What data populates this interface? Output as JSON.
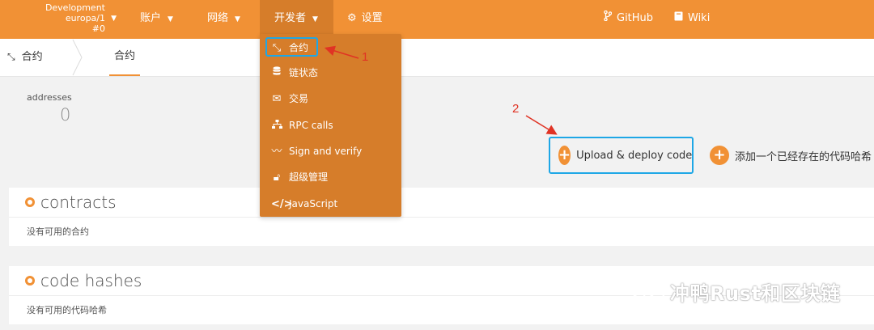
{
  "header": {
    "chain": {
      "line1": "Development",
      "line2": "europa/1",
      "line3": "#0"
    },
    "nav": [
      {
        "label": "账户"
      },
      {
        "label": "网络"
      },
      {
        "label": "开发者"
      },
      {
        "label": "设置",
        "icon": "gears-icon"
      }
    ],
    "links": [
      {
        "label": "GitHub",
        "icon": "branch-icon"
      },
      {
        "label": "Wiki",
        "icon": "book-icon"
      }
    ]
  },
  "subnav": {
    "crumb": "合约",
    "tab": "合约"
  },
  "summary": {
    "label": "addresses",
    "value": "0"
  },
  "actions": {
    "upload": "Upload & deploy code",
    "add_existing": "添加一个已经存在的代码哈希"
  },
  "sections": [
    {
      "title": "contracts",
      "empty": "没有可用的合约"
    },
    {
      "title": "code hashes",
      "empty": "没有可用的代码哈希"
    }
  ],
  "dropdown": [
    {
      "label": "合约",
      "icon": "compress-icon"
    },
    {
      "label": "链状态",
      "icon": "database-icon"
    },
    {
      "label": "交易",
      "icon": "envelope-icon"
    },
    {
      "label": "RPC calls",
      "icon": "sitemap-icon"
    },
    {
      "label": "Sign and verify",
      "icon": "signature-icon"
    },
    {
      "label": "超级管理",
      "icon": "unlock-icon"
    },
    {
      "label": "JavaScript",
      "icon": "code-icon"
    }
  ],
  "annotations": {
    "n1": "1",
    "n2": "2"
  },
  "watermark": "冲鸭Rust和区块链",
  "colors": {
    "accent": "#f19135",
    "active": "#d67d2a",
    "highlight": "#1ea7e6",
    "annotation": "#e03324"
  }
}
